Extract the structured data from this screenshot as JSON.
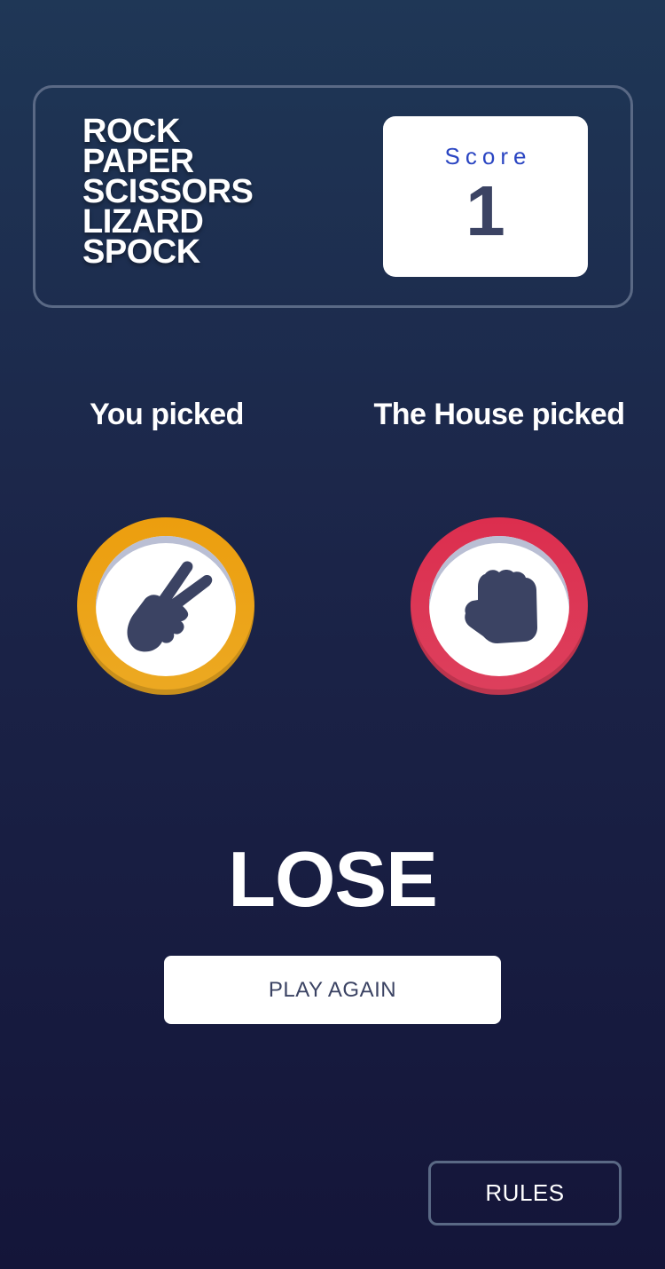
{
  "header": {
    "title_lines": [
      "ROCK",
      "PAPER",
      "SCISSORS",
      "LIZARD",
      "SPOCK"
    ],
    "score_label": "Score",
    "score_value": "1"
  },
  "picks": {
    "you_label": "You picked",
    "house_label": "The House picked",
    "you_choice_icon": "scissors-icon",
    "house_choice_icon": "rock-icon"
  },
  "result": {
    "text": "LOSE",
    "play_again_label": "PLAY AGAIN"
  },
  "footer": {
    "rules_label": "RULES"
  },
  "colors": {
    "scissors": "#eca922",
    "rock": "#dc2e4e",
    "score_label": "#2a45c2",
    "dark_text": "#3b4363"
  }
}
